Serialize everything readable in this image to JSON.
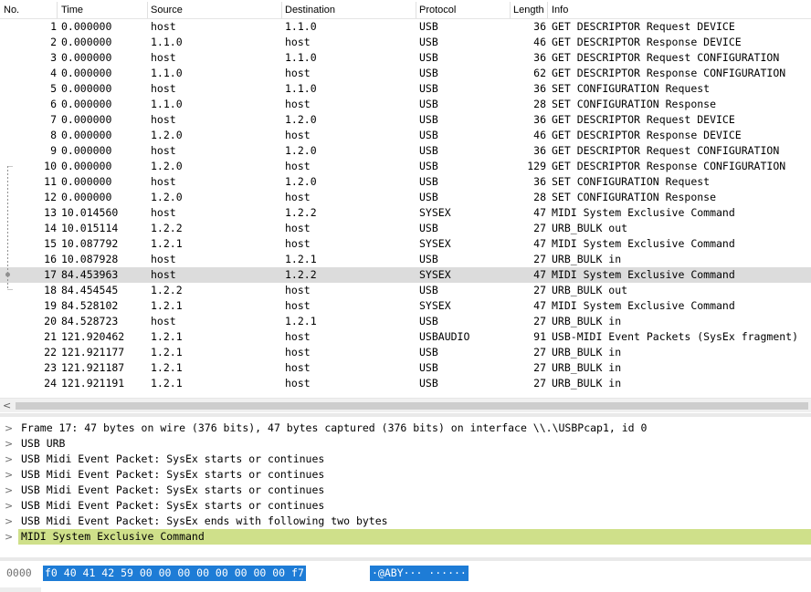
{
  "columns": {
    "no": "No.",
    "time": "Time",
    "source": "Source",
    "destination": "Destination",
    "protocol": "Protocol",
    "length": "Length",
    "info": "Info"
  },
  "packets": [
    {
      "no": "1",
      "time": "0.000000",
      "source": "host",
      "destination": "1.1.0",
      "protocol": "USB",
      "length": "36",
      "info": "GET DESCRIPTOR Request DEVICE"
    },
    {
      "no": "2",
      "time": "0.000000",
      "source": "1.1.0",
      "destination": "host",
      "protocol": "USB",
      "length": "46",
      "info": "GET DESCRIPTOR Response DEVICE"
    },
    {
      "no": "3",
      "time": "0.000000",
      "source": "host",
      "destination": "1.1.0",
      "protocol": "USB",
      "length": "36",
      "info": "GET DESCRIPTOR Request CONFIGURATION"
    },
    {
      "no": "4",
      "time": "0.000000",
      "source": "1.1.0",
      "destination": "host",
      "protocol": "USB",
      "length": "62",
      "info": "GET DESCRIPTOR Response CONFIGURATION"
    },
    {
      "no": "5",
      "time": "0.000000",
      "source": "host",
      "destination": "1.1.0",
      "protocol": "USB",
      "length": "36",
      "info": "SET CONFIGURATION Request"
    },
    {
      "no": "6",
      "time": "0.000000",
      "source": "1.1.0",
      "destination": "host",
      "protocol": "USB",
      "length": "28",
      "info": "SET CONFIGURATION Response"
    },
    {
      "no": "7",
      "time": "0.000000",
      "source": "host",
      "destination": "1.2.0",
      "protocol": "USB",
      "length": "36",
      "info": "GET DESCRIPTOR Request DEVICE"
    },
    {
      "no": "8",
      "time": "0.000000",
      "source": "1.2.0",
      "destination": "host",
      "protocol": "USB",
      "length": "46",
      "info": "GET DESCRIPTOR Response DEVICE"
    },
    {
      "no": "9",
      "time": "0.000000",
      "source": "host",
      "destination": "1.2.0",
      "protocol": "USB",
      "length": "36",
      "info": "GET DESCRIPTOR Request CONFIGURATION"
    },
    {
      "no": "10",
      "time": "0.000000",
      "source": "1.2.0",
      "destination": "host",
      "protocol": "USB",
      "length": "129",
      "info": "GET DESCRIPTOR Response CONFIGURATION"
    },
    {
      "no": "11",
      "time": "0.000000",
      "source": "host",
      "destination": "1.2.0",
      "protocol": "USB",
      "length": "36",
      "info": "SET CONFIGURATION Request"
    },
    {
      "no": "12",
      "time": "0.000000",
      "source": "1.2.0",
      "destination": "host",
      "protocol": "USB",
      "length": "28",
      "info": "SET CONFIGURATION Response"
    },
    {
      "no": "13",
      "time": "10.014560",
      "source": "host",
      "destination": "1.2.2",
      "protocol": "SYSEX",
      "length": "47",
      "info": "MIDI System Exclusive Command"
    },
    {
      "no": "14",
      "time": "10.015114",
      "source": "1.2.2",
      "destination": "host",
      "protocol": "USB",
      "length": "27",
      "info": "URB_BULK out"
    },
    {
      "no": "15",
      "time": "10.087792",
      "source": "1.2.1",
      "destination": "host",
      "protocol": "SYSEX",
      "length": "47",
      "info": "MIDI System Exclusive Command"
    },
    {
      "no": "16",
      "time": "10.087928",
      "source": "host",
      "destination": "1.2.1",
      "protocol": "USB",
      "length": "27",
      "info": "URB_BULK in"
    },
    {
      "no": "17",
      "time": "84.453963",
      "source": "host",
      "destination": "1.2.2",
      "protocol": "SYSEX",
      "length": "47",
      "info": "MIDI System Exclusive Command",
      "selected": true
    },
    {
      "no": "18",
      "time": "84.454545",
      "source": "1.2.2",
      "destination": "host",
      "protocol": "USB",
      "length": "27",
      "info": "URB_BULK out"
    },
    {
      "no": "19",
      "time": "84.528102",
      "source": "1.2.1",
      "destination": "host",
      "protocol": "SYSEX",
      "length": "47",
      "info": "MIDI System Exclusive Command"
    },
    {
      "no": "20",
      "time": "84.528723",
      "source": "host",
      "destination": "1.2.1",
      "protocol": "USB",
      "length": "27",
      "info": "URB_BULK in"
    },
    {
      "no": "21",
      "time": "121.920462",
      "source": "1.2.1",
      "destination": "host",
      "protocol": "USBAUDIO",
      "length": "91",
      "info": "USB-MIDI Event Packets (SysEx fragment)"
    },
    {
      "no": "22",
      "time": "121.921177",
      "source": "1.2.1",
      "destination": "host",
      "protocol": "USB",
      "length": "27",
      "info": "URB_BULK in"
    },
    {
      "no": "23",
      "time": "121.921187",
      "source": "1.2.1",
      "destination": "host",
      "protocol": "USB",
      "length": "27",
      "info": "URB_BULK in"
    },
    {
      "no": "24",
      "time": "121.921191",
      "source": "1.2.1",
      "destination": "host",
      "protocol": "USB",
      "length": "27",
      "info": "URB_BULK in"
    }
  ],
  "hscroll": {
    "left_arrow": "<"
  },
  "details": [
    {
      "arrow": ">",
      "text": "Frame 17: 47 bytes on wire (376 bits), 47 bytes captured (376 bits) on interface \\\\.\\USBPcap1, id 0"
    },
    {
      "arrow": ">",
      "text": "USB URB"
    },
    {
      "arrow": ">",
      "text": "USB Midi Event Packet: SysEx starts or continues"
    },
    {
      "arrow": ">",
      "text": "USB Midi Event Packet: SysEx starts or continues"
    },
    {
      "arrow": ">",
      "text": "USB Midi Event Packet: SysEx starts or continues"
    },
    {
      "arrow": ">",
      "text": "USB Midi Event Packet: SysEx starts or continues"
    },
    {
      "arrow": ">",
      "text": "USB Midi Event Packet: SysEx ends with following two bytes"
    },
    {
      "arrow": ">",
      "text": "MIDI System Exclusive Command",
      "highlighted": true
    }
  ],
  "bytes": {
    "offset": "0000",
    "hex": "f0 40 41 42 59 00 00 00  00 00 00 00 00 f7",
    "ascii": "·@ABY··· ······"
  },
  "colors": {
    "selected_row": "#dcdcdc",
    "highlight": "#cfe08a",
    "byte_selection": "#1e7cd6"
  }
}
